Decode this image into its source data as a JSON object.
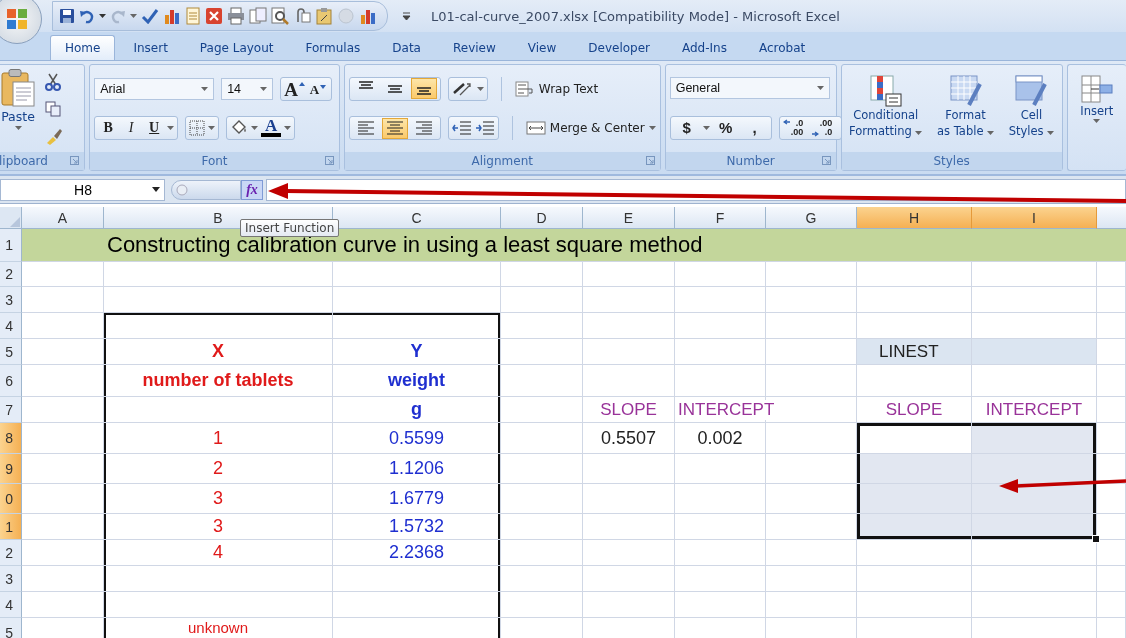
{
  "title_bar": {
    "title": "L01-cal-curve_2007.xlsx  [Compatibility Mode] - Microsoft Excel"
  },
  "tabs": [
    {
      "label": "Home",
      "selected": true
    },
    {
      "label": "Insert",
      "selected": false
    },
    {
      "label": "Page Layout",
      "selected": false
    },
    {
      "label": "Formulas",
      "selected": false
    },
    {
      "label": "Data",
      "selected": false
    },
    {
      "label": "Review",
      "selected": false
    },
    {
      "label": "View",
      "selected": false
    },
    {
      "label": "Developer",
      "selected": false
    },
    {
      "label": "Add-Ins",
      "selected": false
    },
    {
      "label": "Acrobat",
      "selected": false
    }
  ],
  "ribbon": {
    "clipboard": {
      "label": "lipboard",
      "paste": "Paste"
    },
    "font": {
      "label": "Font",
      "font_name": "Arial",
      "font_size": "14",
      "grow": "A",
      "shrink": "A",
      "bold": "B",
      "italic": "I",
      "underline": "U",
      "font_color": "A"
    },
    "alignment": {
      "label": "Alignment",
      "vertical": [
        {
          "kind": "top",
          "selected": false
        },
        {
          "kind": "middle",
          "selected": false
        },
        {
          "kind": "bottom",
          "selected": true
        }
      ],
      "horizontal": [
        {
          "kind": "left",
          "selected": false
        },
        {
          "kind": "center",
          "selected": true
        },
        {
          "kind": "right",
          "selected": false
        }
      ],
      "wrap_text": "Wrap Text",
      "merge": "Merge & Center"
    },
    "number": {
      "label": "Number",
      "format": "General",
      "currency": "$",
      "percent": "%",
      "comma": ",",
      "decimals": [
        {
          "kind": "increase",
          "top": ".0",
          "bottom": ".00"
        },
        {
          "kind": "decrease",
          "top": ".00",
          "bottom": ".0"
        }
      ]
    },
    "styles": {
      "label": "Styles",
      "buttons": [
        {
          "kind": "conditional",
          "lines": [
            "Conditional",
            "Formatting"
          ]
        },
        {
          "kind": "table",
          "lines": [
            "Format",
            "as Table"
          ]
        },
        {
          "kind": "cell",
          "lines": [
            "Cell",
            "Styles"
          ]
        }
      ]
    },
    "cells": {
      "insert": "Insert"
    }
  },
  "formula_bar": {
    "name_box": "H8",
    "function_button": "fx",
    "tooltip": "Insert Function"
  },
  "sheet": {
    "columns": [
      {
        "label": "A",
        "selected": false
      },
      {
        "label": "B",
        "selected": false
      },
      {
        "label": "C",
        "selected": false
      },
      {
        "label": "D",
        "selected": false
      },
      {
        "label": "E",
        "selected": false
      },
      {
        "label": "F",
        "selected": false
      },
      {
        "label": "G",
        "selected": false
      },
      {
        "label": "H",
        "selected": true
      },
      {
        "label": "I",
        "selected": true
      }
    ],
    "rows": [
      {
        "label": "1",
        "selected": false,
        "kind": "banner",
        "cells": [
          null,
          {
            "text": "Constructing calibration curve in using a least square method",
            "kind": "title"
          },
          null,
          null,
          null,
          null,
          null,
          null,
          null
        ]
      },
      {
        "label": "2",
        "selected": false,
        "kind": "plain",
        "cells": [
          null,
          null,
          null,
          null,
          null,
          null,
          null,
          null,
          null
        ]
      },
      {
        "label": "3",
        "selected": false,
        "kind": "plain",
        "cells": [
          null,
          null,
          null,
          null,
          null,
          null,
          null,
          null,
          null
        ]
      },
      {
        "label": "4",
        "selected": false,
        "kind": "plain",
        "cells": [
          null,
          {
            "frame": true
          },
          {
            "frame": true
          },
          null,
          null,
          null,
          null,
          null,
          null
        ]
      },
      {
        "label": "5",
        "selected": false,
        "kind": "plain",
        "cells": [
          null,
          {
            "text": "X",
            "kind": "x-heading",
            "frame": true
          },
          {
            "text": "Y",
            "kind": "y-heading",
            "frame": true
          },
          null,
          null,
          null,
          null,
          {
            "text": "LINEST",
            "kind": "section-label",
            "left_aligned": true
          },
          {
            "kind": "shaded"
          }
        ]
      },
      {
        "label": "6",
        "selected": false,
        "kind": "plain",
        "cells": [
          null,
          {
            "text": "number of tablets",
            "kind": "x-heading",
            "frame": true
          },
          {
            "text": "weight",
            "kind": "y-heading",
            "frame": true
          },
          null,
          null,
          null,
          null,
          null,
          null
        ]
      },
      {
        "label": "7",
        "selected": false,
        "kind": "plain",
        "cells": [
          null,
          {
            "frame": true
          },
          {
            "text": "g",
            "kind": "y-heading",
            "frame": true
          },
          null,
          {
            "text": "SLOPE",
            "kind": "label"
          },
          {
            "text": "INTERCEPT",
            "kind": "label",
            "left_aligned": true
          },
          null,
          {
            "text": "SLOPE",
            "kind": "label"
          },
          {
            "text": "INTERCEPT",
            "kind": "label"
          }
        ]
      },
      {
        "label": "8",
        "selected": true,
        "kind": "plain",
        "cells": [
          null,
          {
            "text": "1",
            "kind": "x-value",
            "frame": true
          },
          {
            "text": "0.5599",
            "kind": "y-value",
            "frame": true
          },
          null,
          {
            "text": "0.5507",
            "kind": "value"
          },
          {
            "text": "0.002",
            "kind": "value"
          },
          null,
          {
            "selected": true,
            "active": true
          },
          {
            "selected": true,
            "active": false
          }
        ]
      },
      {
        "label": "9",
        "selected": true,
        "kind": "plain",
        "cells": [
          null,
          {
            "text": "2",
            "kind": "x-value",
            "frame": true
          },
          {
            "text": "1.1206",
            "kind": "y-value",
            "frame": true
          },
          null,
          null,
          null,
          null,
          {
            "selected": true,
            "active": false
          },
          {
            "selected": true,
            "active": false
          }
        ]
      },
      {
        "label": "0",
        "selected": true,
        "kind": "plain",
        "cells": [
          null,
          {
            "text": "3",
            "kind": "x-value",
            "frame": true
          },
          {
            "text": "1.6779",
            "kind": "y-value",
            "frame": true
          },
          null,
          null,
          null,
          null,
          {
            "selected": true,
            "active": false
          },
          {
            "selected": true,
            "active": false
          }
        ]
      },
      {
        "label": "1",
        "selected": true,
        "kind": "plain",
        "cells": [
          null,
          {
            "text": "3",
            "kind": "x-value",
            "frame": true
          },
          {
            "text": "1.5732",
            "kind": "y-value",
            "frame": true
          },
          null,
          null,
          null,
          null,
          {
            "selected": true,
            "active": false
          },
          {
            "selected": true,
            "active": false
          }
        ]
      },
      {
        "label": "2",
        "selected": false,
        "kind": "plain",
        "cells": [
          null,
          {
            "text": "4",
            "kind": "x-value",
            "frame": true
          },
          {
            "text": "2.2368",
            "kind": "y-value",
            "frame": true
          },
          null,
          null,
          null,
          null,
          null,
          null
        ]
      },
      {
        "label": "3",
        "selected": false,
        "kind": "plain",
        "cells": [
          null,
          {
            "frame": true
          },
          {
            "frame": true
          },
          null,
          null,
          null,
          null,
          null,
          null
        ]
      },
      {
        "label": "4",
        "selected": false,
        "kind": "plain",
        "cells": [
          null,
          {
            "frame": true
          },
          {
            "frame": true
          },
          null,
          null,
          null,
          null,
          null,
          null
        ]
      },
      {
        "label": "5",
        "selected": false,
        "kind": "plain",
        "cells": [
          null,
          {
            "text": "unknown",
            "kind": "note",
            "frame": true
          },
          {
            "frame": true
          },
          null,
          null,
          null,
          null,
          null,
          null
        ]
      }
    ]
  }
}
